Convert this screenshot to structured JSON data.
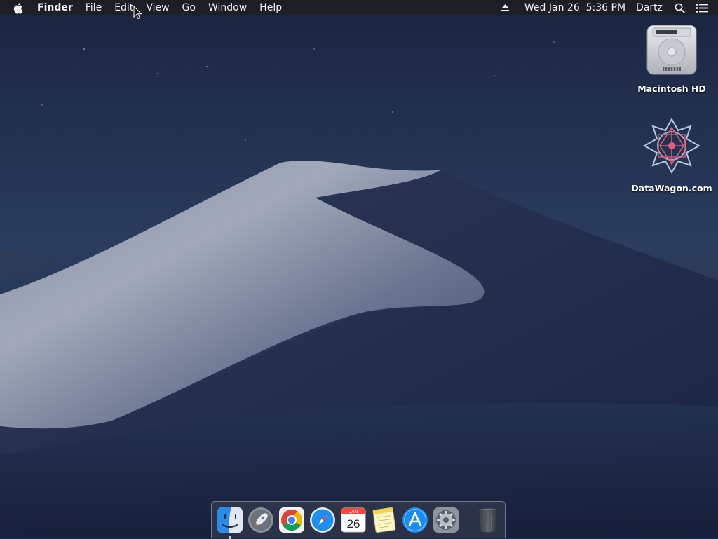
{
  "menubar": {
    "apple_icon": "apple-logo-icon",
    "app_name": "Finder",
    "menus": [
      "File",
      "Edit",
      "View",
      "Go",
      "Window",
      "Help"
    ],
    "status": {
      "eject_icon": "eject-icon",
      "datetime": "Wed Jan 26  5:36 PM",
      "user": "Dartz",
      "spotlight_icon": "spotlight-search-icon",
      "notification_icon": "notification-center-icon"
    }
  },
  "desktop_icons": [
    {
      "label": "Macintosh HD",
      "icon": "hard-drive-icon"
    },
    {
      "label": "DataWagon.com",
      "icon": "network-volume-icon"
    }
  ],
  "dock": {
    "apps": [
      {
        "name": "Finder",
        "icon": "finder-icon",
        "running": true
      },
      {
        "name": "Launchpad",
        "icon": "launchpad-rocket-icon",
        "running": false
      },
      {
        "name": "Google Chrome",
        "icon": "chrome-icon",
        "running": false
      },
      {
        "name": "Safari",
        "icon": "safari-compass-icon",
        "running": false
      },
      {
        "name": "Calendar",
        "icon": "calendar-icon",
        "running": false,
        "month": "JAN",
        "day": "26"
      },
      {
        "name": "Notes",
        "icon": "notes-icon",
        "running": false
      },
      {
        "name": "App Store",
        "icon": "app-store-icon",
        "running": false
      },
      {
        "name": "System Preferences",
        "icon": "gear-icon",
        "running": false
      }
    ],
    "trash": {
      "name": "Trash",
      "icon": "trash-icon"
    }
  },
  "colors": {
    "sky_top": "#1a2540",
    "sky_bottom": "#3a4d6e",
    "dune_light": "#8f97ab",
    "dune_dark": "#1f2a48"
  }
}
